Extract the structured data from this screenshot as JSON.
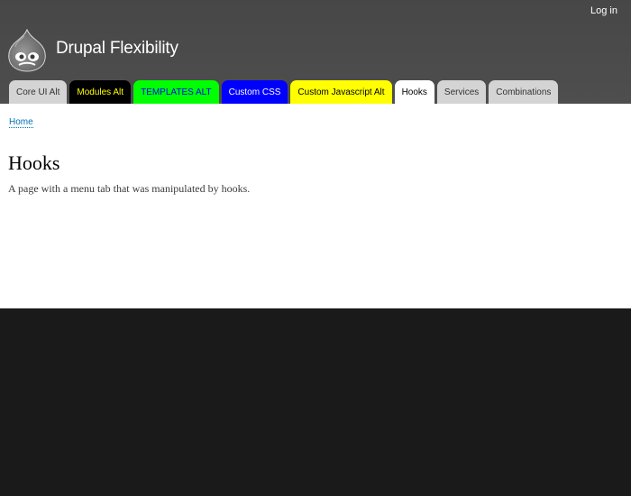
{
  "header": {
    "login_label": "Log in",
    "site_name": "Drupal Flexibility",
    "background": "#4a4a4a"
  },
  "tabs": [
    {
      "label": "Core UI Alt",
      "bg": "#d4d4d4",
      "fg": "#333333",
      "active": false
    },
    {
      "label": "Modules Alt",
      "bg": "#000000",
      "fg": "#ffff00",
      "active": false
    },
    {
      "label": "TEMPLATES ALT",
      "bg": "#00ff00",
      "fg": "#0000ff",
      "active": false
    },
    {
      "label": "Custom CSS",
      "bg": "#0000ff",
      "fg": "#ffffff",
      "active": false
    },
    {
      "label": "Custom Javascript Alt",
      "bg": "#ffff00",
      "fg": "#000000",
      "active": false
    },
    {
      "label": "Hooks",
      "bg": "#ffffff",
      "fg": "#000000",
      "active": true
    },
    {
      "label": "Services",
      "bg": "#d4d4d4",
      "fg": "#333333",
      "active": false
    },
    {
      "label": "Combinations",
      "bg": "#d4d4d4",
      "fg": "#333333",
      "active": false
    }
  ],
  "breadcrumb": {
    "home_label": "Home"
  },
  "page": {
    "title": "Hooks",
    "body": "A page with a menu tab that was manipulated by hooks."
  },
  "icons": {
    "logo": "drupal-drop-icon"
  }
}
